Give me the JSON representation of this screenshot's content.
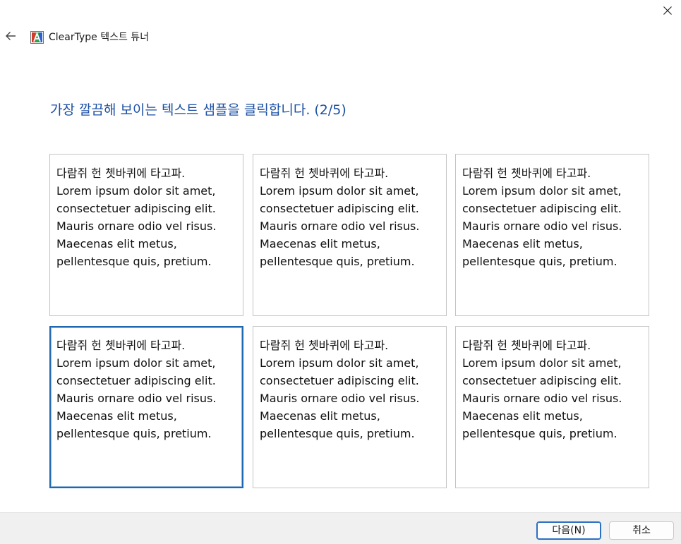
{
  "window": {
    "title": "ClearType 텍스트 튜너",
    "close_icon": "close-icon",
    "back_icon": "back-arrow-icon",
    "app_icon": "cleartype-app-icon"
  },
  "page": {
    "instruction": "가장 깔끔해 보이는 텍스트 샘플을 클릭합니다. (2/5)"
  },
  "samples": [
    {
      "text": "다람쥐 헌 쳇바퀴에 타고파.\nLorem ipsum dolor sit amet,\nconsectetuer adipiscing elit.\nMauris ornare odio vel risus.\nMaecenas elit metus,\npellentesque quis, pretium.",
      "selected": false
    },
    {
      "text": "다람쥐 헌 쳇바퀴에 타고파.\nLorem ipsum dolor sit amet,\nconsectetuer adipiscing elit.\nMauris ornare odio vel risus.\nMaecenas elit metus,\npellentesque quis, pretium.",
      "selected": false
    },
    {
      "text": "다람쥐 헌 쳇바퀴에 타고파.\nLorem ipsum dolor sit amet,\nconsectetuer adipiscing elit.\nMauris ornare odio vel risus.\nMaecenas elit metus,\npellentesque quis, pretium.",
      "selected": false
    },
    {
      "text": "다람쥐 헌 쳇바퀴에 타고파.\nLorem ipsum dolor sit amet,\nconsectetuer adipiscing elit.\nMauris ornare odio vel risus.\nMaecenas elit metus,\npellentesque quis, pretium.",
      "selected": true
    },
    {
      "text": "다람쥐 헌 쳇바퀴에 타고파.\nLorem ipsum dolor sit amet,\nconsectetuer adipiscing elit.\nMauris ornare odio vel risus.\nMaecenas elit metus,\npellentesque quis, pretium.",
      "selected": false
    },
    {
      "text": "다람쥐 헌 쳇바퀴에 타고파.\nLorem ipsum dolor sit amet,\nconsectetuer adipiscing elit.\nMauris ornare odio vel risus.\nMaecenas elit metus,\npellentesque quis, pretium.",
      "selected": false
    }
  ],
  "footer": {
    "next_label": "다음(N)",
    "cancel_label": "취소"
  },
  "colors": {
    "instruction": "#1b4fa3",
    "selection_border": "#1f67b0",
    "footer_bg": "#f0f0f0"
  }
}
